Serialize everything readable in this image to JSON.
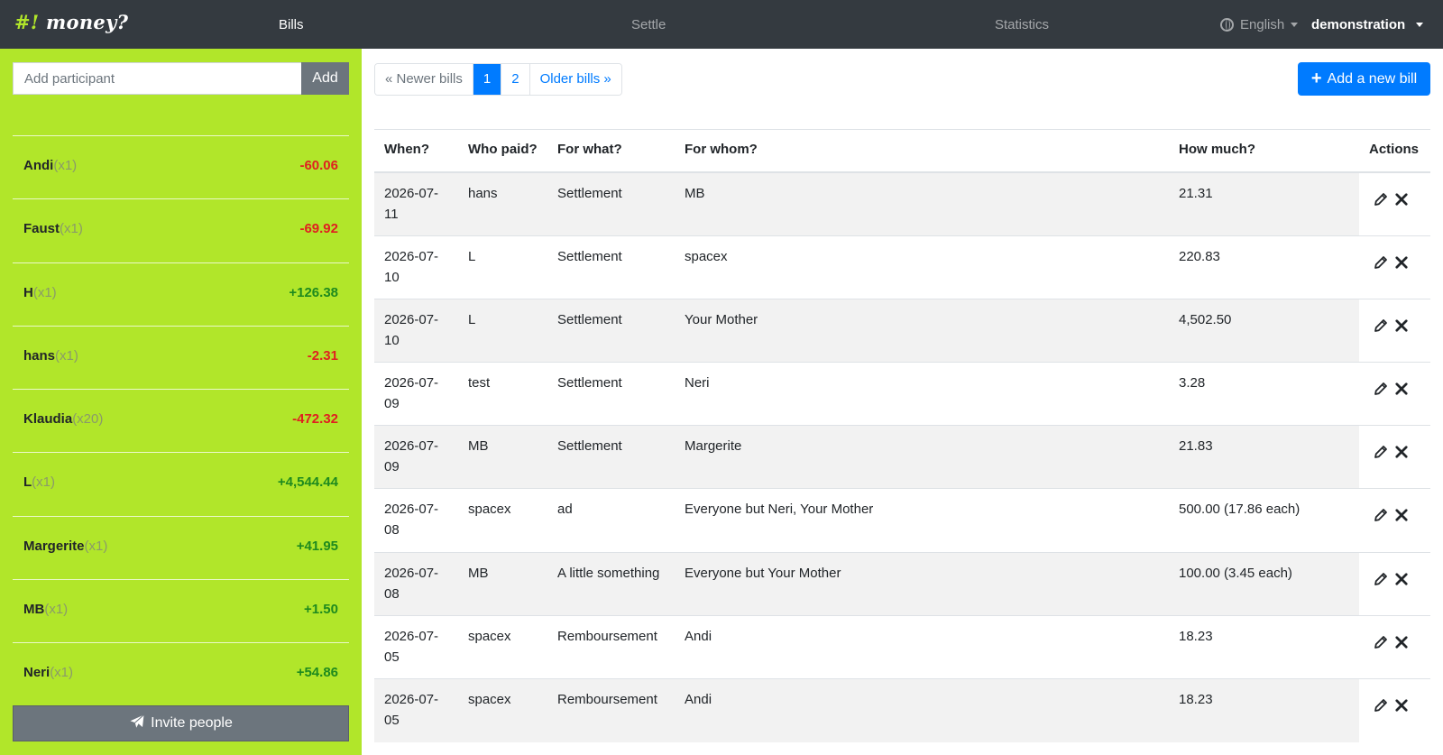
{
  "nav": {
    "brand_hash": "#!",
    "brand_text": " money?",
    "bills": "Bills",
    "settle": "Settle",
    "statistics": "Statistics",
    "language": "English",
    "project": "demonstration"
  },
  "sidebar": {
    "add_placeholder": "Add participant",
    "add_label": "Add",
    "invite_label": "Invite people",
    "balances": [
      {
        "name": "Andi",
        "weight": "(x1)",
        "amount": "-60.06",
        "sign": "neg"
      },
      {
        "name": "Faust",
        "weight": "(x1)",
        "amount": "-69.92",
        "sign": "neg"
      },
      {
        "name": "H",
        "weight": "(x1)",
        "amount": "+126.38",
        "sign": "pos"
      },
      {
        "name": "hans",
        "weight": "(x1)",
        "amount": "-2.31",
        "sign": "neg"
      },
      {
        "name": "Klaudia",
        "weight": "(x20)",
        "amount": "-472.32",
        "sign": "neg"
      },
      {
        "name": "L",
        "weight": "(x1)",
        "amount": "+4,544.44",
        "sign": "pos"
      },
      {
        "name": "Margerite",
        "weight": "(x1)",
        "amount": "+41.95",
        "sign": "pos"
      },
      {
        "name": "MB",
        "weight": "(x1)",
        "amount": "+1.50",
        "sign": "pos"
      },
      {
        "name": "Neri",
        "weight": "(x1)",
        "amount": "+54.86",
        "sign": "pos"
      }
    ]
  },
  "pagination": {
    "newer": "« Newer bills",
    "page1": "1",
    "page2": "2",
    "older": "Older bills »"
  },
  "add_bill_label": "Add a new bill",
  "table": {
    "headers": {
      "when": "When?",
      "who_paid": "Who paid?",
      "for_what": "For what?",
      "for_whom": "For whom?",
      "how_much": "How much?",
      "actions": "Actions"
    },
    "rows": [
      {
        "when": "2026-07-11",
        "who": "hans",
        "what": "Settlement",
        "whom": "MB",
        "much": "21.31"
      },
      {
        "when": "2026-07-10",
        "who": "L",
        "what": "Settlement",
        "whom": "spacex",
        "much": "220.83"
      },
      {
        "when": "2026-07-10",
        "who": "L",
        "what": "Settlement",
        "whom": "Your Mother",
        "much": "4,502.50"
      },
      {
        "when": "2026-07-09",
        "who": "test",
        "what": "Settlement",
        "whom": "Neri",
        "much": "3.28"
      },
      {
        "when": "2026-07-09",
        "who": "MB",
        "what": "Settlement",
        "whom": "Margerite",
        "much": "21.83"
      },
      {
        "when": "2026-07-08",
        "who": "spacex",
        "what": "ad",
        "whom": "Everyone but Neri, Your Mother",
        "much": "500.00 (17.86 each)"
      },
      {
        "when": "2026-07-08",
        "who": "MB",
        "what": "A little something",
        "whom": "Everyone but Your Mother",
        "much": "100.00 (3.45 each)"
      },
      {
        "when": "2026-07-05",
        "who": "spacex",
        "what": "Remboursement",
        "whom": "Andi",
        "much": "18.23"
      },
      {
        "when": "2026-07-05",
        "who": "spacex",
        "what": "Remboursement",
        "whom": "Andi",
        "much": "18.23"
      }
    ]
  },
  "colors": {
    "navbar": "#343a40",
    "sidebar": "#b1e62a",
    "primary": "#007bff",
    "negative": "#e02020",
    "positive": "#1e8a1e",
    "secondary": "#6c757d"
  }
}
